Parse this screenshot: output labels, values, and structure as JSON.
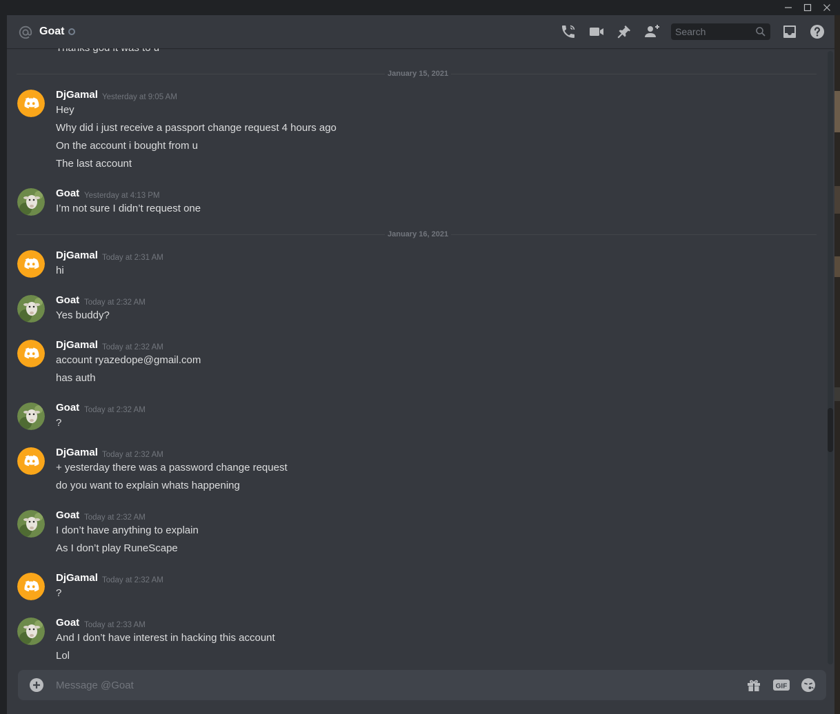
{
  "window": {
    "minimize_icon": "minimize-icon",
    "maximize_icon": "maximize-icon",
    "close_icon": "close-icon"
  },
  "header": {
    "recipient_name": "Goat",
    "status": "offline",
    "icons": [
      "at-sign-icon",
      "phone-call-icon",
      "video-call-icon",
      "pin-icon",
      "add-friend-icon",
      "inbox-icon",
      "help-icon"
    ],
    "search_placeholder": "Search"
  },
  "chat": {
    "partial_top_text": "Thanks god it was to u",
    "dividers": {
      "first": "January 15, 2021",
      "second": "January 16, 2021"
    },
    "groups": [
      {
        "author": "DjGamal",
        "timestamp": "Yesterday at 9:05 AM",
        "lines": [
          "Hey",
          "Why did i just receive a passport change request 4 hours ago",
          "On the account i bought from u",
          "The last account"
        ]
      },
      {
        "author": "Goat",
        "timestamp": "Yesterday at 4:13 PM",
        "lines": [
          "I’m not sure I didn’t request one"
        ]
      },
      {
        "author": "DjGamal",
        "timestamp": "Today at 2:31 AM",
        "lines": [
          "hi"
        ]
      },
      {
        "author": "Goat",
        "timestamp": "Today at 2:32 AM",
        "lines": [
          "Yes buddy?"
        ]
      },
      {
        "author": "DjGamal",
        "timestamp": "Today at 2:32 AM",
        "lines": [
          "account ryazedope@gmail.com",
          "has auth"
        ]
      },
      {
        "author": "Goat",
        "timestamp": "Today at 2:32 AM",
        "lines": [
          "?"
        ]
      },
      {
        "author": "DjGamal",
        "timestamp": "Today at 2:32 AM",
        "lines": [
          "+ yesterday there was a password change request",
          "do you want to explain whats happening"
        ]
      },
      {
        "author": "Goat",
        "timestamp": "Today at 2:32 AM",
        "lines": [
          "I don’t have anything to explain",
          "As I don’t play RuneScape"
        ]
      },
      {
        "author": "DjGamal",
        "timestamp": "Today at 2:32 AM",
        "lines": [
          "?"
        ]
      },
      {
        "author": "Goat",
        "timestamp": "Today at 2:33 AM",
        "lines": [
          "And I don’t have interest in hacking this account",
          "Lol"
        ]
      }
    ]
  },
  "composer": {
    "placeholder": "Message @Goat",
    "icons": [
      "add-attachment-icon",
      "gift-icon",
      "gif-icon",
      "emoji-icon"
    ],
    "gif_label": "GIF"
  },
  "colors": {
    "background": "#36393f",
    "header_text": "#ffffff",
    "message_text": "#dcddde",
    "muted": "#72767d",
    "discord_default_avatar": "#faa61a"
  }
}
